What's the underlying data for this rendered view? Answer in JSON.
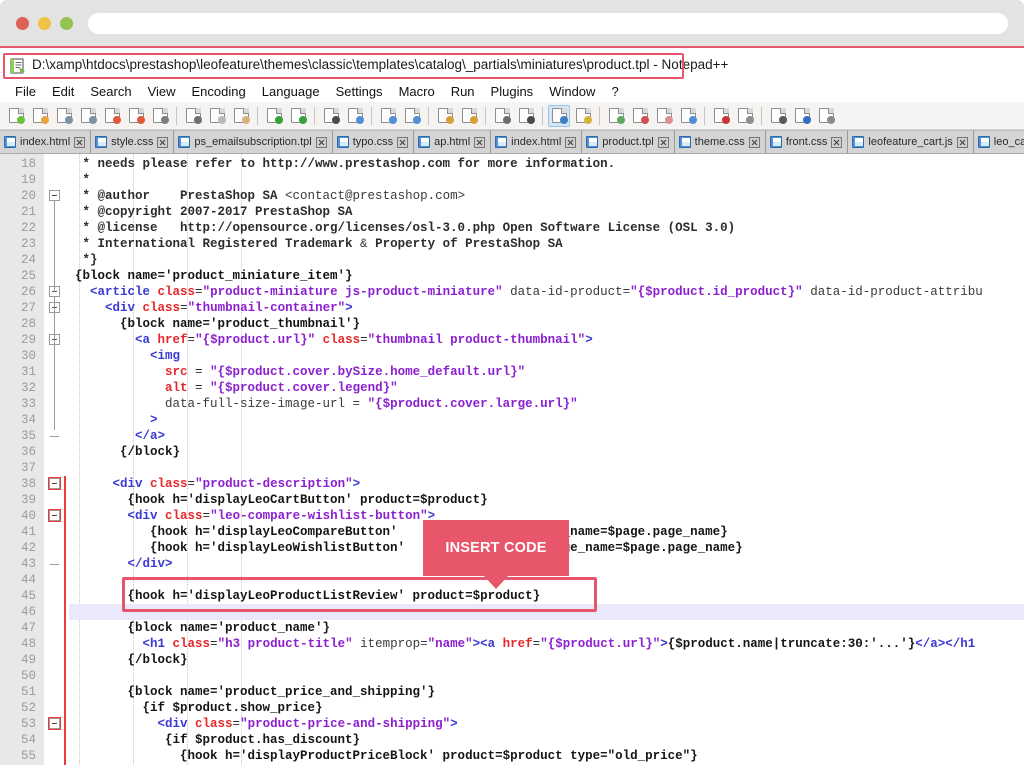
{
  "browser": {
    "traffic_lights": [
      "close",
      "minimize",
      "maximize"
    ],
    "address_value": "",
    "address_placeholder": ""
  },
  "titlebar": {
    "icon": "notepad-plus-plus-icon",
    "title": "D:\\xamp\\htdocs\\prestashop\\leofeature\\themes\\classic\\templates\\catalog\\_partials\\miniatures\\product.tpl - Notepad++",
    "highlight_color": "#e8566b"
  },
  "menu": {
    "items": [
      "File",
      "Edit",
      "Search",
      "View",
      "Encoding",
      "Language",
      "Settings",
      "Macro",
      "Run",
      "Plugins",
      "Window",
      "?"
    ]
  },
  "toolbar": {
    "buttons": [
      "new-file-icon",
      "open-file-icon",
      "save-icon",
      "save-all-icon",
      "close-file-icon",
      "close-all-icon",
      "print-icon",
      "cut-icon",
      "copy-icon",
      "paste-icon",
      "undo-icon",
      "redo-icon",
      "find-icon",
      "replace-icon",
      "zoom-in-icon",
      "zoom-out-icon",
      "sync-vertical-icon",
      "sync-horizontal-icon",
      "word-wrap-icon",
      "show-all-chars-icon",
      "indent-guide-icon",
      "user-defined-dialog-icon",
      "document-map-icon",
      "function-list-icon",
      "folder-workspace-icon",
      "monitoring-icon",
      "record-macro-icon",
      "stop-macro-icon",
      "play-macro-icon",
      "run-macro-multiple-icon",
      "run-dialog-icon"
    ]
  },
  "tabs": [
    {
      "label": "index.html",
      "active": false
    },
    {
      "label": "style.css",
      "active": false
    },
    {
      "label": "ps_emailsubscription.tpl",
      "active": false
    },
    {
      "label": "typo.css",
      "active": false
    },
    {
      "label": "ap.html",
      "active": false
    },
    {
      "label": "index.html",
      "active": false
    },
    {
      "label": "product.tpl",
      "active": true
    },
    {
      "label": "theme.css",
      "active": false
    },
    {
      "label": "front.css",
      "active": false
    },
    {
      "label": "leofeature_cart.js",
      "active": false
    },
    {
      "label": "leo_cart_butto",
      "active": false
    }
  ],
  "editor": {
    "current_line_number": 46,
    "lines": [
      {
        "n": 18,
        "indent": 0,
        "tokens": [
          {
            "t": " * needs please refer to http://www.prestashop.com for more information.",
            "c": "c-comment"
          }
        ]
      },
      {
        "n": 19,
        "indent": 0,
        "tokens": [
          {
            "t": " *",
            "c": "c-comment"
          }
        ]
      },
      {
        "n": 20,
        "indent": 0,
        "fold": "open",
        "tokens": [
          {
            "t": " * @author    PrestaShop SA ",
            "c": "c-comment"
          },
          {
            "t": "<contact@prestashop.com>",
            "c": "c-gray"
          }
        ]
      },
      {
        "n": 21,
        "indent": 0,
        "tokens": [
          {
            "t": " * @copyright 2007-2017 PrestaShop SA",
            "c": "c-comment"
          }
        ]
      },
      {
        "n": 22,
        "indent": 0,
        "tokens": [
          {
            "t": " * @license   http://opensource.org/licenses/osl-3.0.php Open Software License (OSL 3.0)",
            "c": "c-comment"
          }
        ]
      },
      {
        "n": 23,
        "indent": 0,
        "tokens": [
          {
            "t": " * International Registered Trademark ",
            "c": "c-comment"
          },
          {
            "t": "&",
            "c": "c-gray"
          },
          {
            "t": " Property of PrestaShop SA",
            "c": "c-comment"
          }
        ]
      },
      {
        "n": 24,
        "indent": 0,
        "tokens": [
          {
            "t": " *}",
            "c": "c-comment"
          }
        ]
      },
      {
        "n": 25,
        "indent": 0,
        "tokens": [
          {
            "t": "{block name='product_miniature_item'}",
            "c": "c-smarty"
          }
        ]
      },
      {
        "n": 26,
        "indent": 0,
        "fold": "open",
        "tokens": [
          {
            "t": "  ",
            "c": "c-plain"
          },
          {
            "t": "<article ",
            "c": "c-tag"
          },
          {
            "t": "class",
            "c": "c-attr"
          },
          {
            "t": "=",
            "c": "c-punct"
          },
          {
            "t": "\"product-miniature js-product-miniature\"",
            "c": "c-val"
          },
          {
            "t": " data-id-product=",
            "c": "c-gray"
          },
          {
            "t": "\"{$product.id_product}\"",
            "c": "c-val"
          },
          {
            "t": " data-id-product-attribu",
            "c": "c-gray"
          }
        ]
      },
      {
        "n": 27,
        "indent": 0,
        "fold": "open",
        "tokens": [
          {
            "t": "    ",
            "c": "c-plain"
          },
          {
            "t": "<div ",
            "c": "c-tag"
          },
          {
            "t": "class",
            "c": "c-attr"
          },
          {
            "t": "=",
            "c": "c-punct"
          },
          {
            "t": "\"thumbnail-container\"",
            "c": "c-val"
          },
          {
            "t": ">",
            "c": "c-tag"
          }
        ]
      },
      {
        "n": 28,
        "indent": 0,
        "tokens": [
          {
            "t": "      {block name='product_thumbnail'}",
            "c": "c-smarty"
          }
        ]
      },
      {
        "n": 29,
        "indent": 0,
        "fold": "open",
        "tokens": [
          {
            "t": "        ",
            "c": "c-plain"
          },
          {
            "t": "<a ",
            "c": "c-tag"
          },
          {
            "t": "href",
            "c": "c-attr"
          },
          {
            "t": "=",
            "c": "c-punct"
          },
          {
            "t": "\"{$product.url}\"",
            "c": "c-val"
          },
          {
            "t": " ",
            "c": "c-plain"
          },
          {
            "t": "class",
            "c": "c-attr"
          },
          {
            "t": "=",
            "c": "c-punct"
          },
          {
            "t": "\"thumbnail product-thumbnail\"",
            "c": "c-val"
          },
          {
            "t": ">",
            "c": "c-tag"
          }
        ]
      },
      {
        "n": 30,
        "indent": 0,
        "tokens": [
          {
            "t": "          ",
            "c": "c-plain"
          },
          {
            "t": "<img",
            "c": "c-tag"
          }
        ]
      },
      {
        "n": 31,
        "indent": 0,
        "tokens": [
          {
            "t": "            ",
            "c": "c-plain"
          },
          {
            "t": "src",
            "c": "c-attr"
          },
          {
            "t": " = ",
            "c": "c-punct"
          },
          {
            "t": "\"{$product.cover.bySize.home_default.url}\"",
            "c": "c-val"
          }
        ]
      },
      {
        "n": 32,
        "indent": 0,
        "tokens": [
          {
            "t": "            ",
            "c": "c-plain"
          },
          {
            "t": "alt",
            "c": "c-attr"
          },
          {
            "t": " = ",
            "c": "c-punct"
          },
          {
            "t": "\"{$product.cover.legend}\"",
            "c": "c-val"
          }
        ]
      },
      {
        "n": 33,
        "indent": 0,
        "tokens": [
          {
            "t": "            data-full-size-image-url = ",
            "c": "c-gray"
          },
          {
            "t": "\"{$product.cover.large.url}\"",
            "c": "c-val"
          }
        ]
      },
      {
        "n": 34,
        "indent": 0,
        "tokens": [
          {
            "t": "          ",
            "c": "c-plain"
          },
          {
            "t": ">",
            "c": "c-tag"
          }
        ]
      },
      {
        "n": 35,
        "indent": 0,
        "tokens": [
          {
            "t": "        ",
            "c": "c-plain"
          },
          {
            "t": "</a>",
            "c": "c-tag"
          }
        ]
      },
      {
        "n": 36,
        "indent": 0,
        "tokens": [
          {
            "t": "      {/block}",
            "c": "c-smarty"
          }
        ]
      },
      {
        "n": 37,
        "indent": 0,
        "tokens": []
      },
      {
        "n": 38,
        "indent": 0,
        "fold": "open-red",
        "tokens": [
          {
            "t": "     ",
            "c": "c-plain"
          },
          {
            "t": "<div ",
            "c": "c-tag"
          },
          {
            "t": "class",
            "c": "c-attr"
          },
          {
            "t": "=",
            "c": "c-punct"
          },
          {
            "t": "\"product-description\"",
            "c": "c-val"
          },
          {
            "t": ">",
            "c": "c-tag"
          }
        ]
      },
      {
        "n": 39,
        "indent": 0,
        "tokens": [
          {
            "t": "       {hook h='displayLeoCartButton' product=$product}",
            "c": "c-smarty"
          }
        ]
      },
      {
        "n": 40,
        "indent": 0,
        "fold": "open-red",
        "tokens": [
          {
            "t": "       ",
            "c": "c-plain"
          },
          {
            "t": "<div ",
            "c": "c-tag"
          },
          {
            "t": "class",
            "c": "c-attr"
          },
          {
            "t": "=",
            "c": "c-punct"
          },
          {
            "t": "\"leo-compare-wishlist-button\"",
            "c": "c-val"
          },
          {
            "t": ">",
            "c": "c-tag"
          }
        ]
      },
      {
        "n": 41,
        "indent": 0,
        "tokens": [
          {
            "t": "          {hook h='displayLeoCompareButton'                   age_name=$page.page_name}",
            "c": "c-smarty"
          }
        ]
      },
      {
        "n": 42,
        "indent": 0,
        "tokens": [
          {
            "t": "          {hook h='displayLeoWishlistButton'                   page_name=$page.page_name}",
            "c": "c-smarty"
          }
        ]
      },
      {
        "n": 43,
        "indent": 0,
        "tokens": [
          {
            "t": "       ",
            "c": "c-plain"
          },
          {
            "t": "</div>",
            "c": "c-tag"
          }
        ]
      },
      {
        "n": 44,
        "indent": 0,
        "tokens": []
      },
      {
        "n": 45,
        "indent": 0,
        "tokens": [
          {
            "t": "       {hook h='displayLeoProductListReview' product=$product}",
            "c": "c-smarty"
          }
        ]
      },
      {
        "n": 46,
        "indent": 0,
        "tokens": []
      },
      {
        "n": 47,
        "indent": 0,
        "tokens": [
          {
            "t": "       {block name='product_name'}",
            "c": "c-smarty"
          }
        ]
      },
      {
        "n": 48,
        "indent": 0,
        "tokens": [
          {
            "t": "         ",
            "c": "c-plain"
          },
          {
            "t": "<h1 ",
            "c": "c-tag"
          },
          {
            "t": "class",
            "c": "c-attr"
          },
          {
            "t": "=",
            "c": "c-punct"
          },
          {
            "t": "\"h3 product-title\"",
            "c": "c-val"
          },
          {
            "t": " itemprop=",
            "c": "c-gray"
          },
          {
            "t": "\"name\"",
            "c": "c-val"
          },
          {
            "t": ">",
            "c": "c-tag"
          },
          {
            "t": "<a ",
            "c": "c-tag"
          },
          {
            "t": "href",
            "c": "c-attr"
          },
          {
            "t": "=",
            "c": "c-punct"
          },
          {
            "t": "\"{$product.url}\"",
            "c": "c-val"
          },
          {
            "t": ">",
            "c": "c-tag"
          },
          {
            "t": "{$product.name|truncate:30:'...'}",
            "c": "c-smarty"
          },
          {
            "t": "</a></h1",
            "c": "c-tag"
          }
        ]
      },
      {
        "n": 49,
        "indent": 0,
        "tokens": [
          {
            "t": "       {/block}",
            "c": "c-smarty"
          }
        ]
      },
      {
        "n": 50,
        "indent": 0,
        "tokens": []
      },
      {
        "n": 51,
        "indent": 0,
        "tokens": [
          {
            "t": "       {block name='product_price_and_shipping'}",
            "c": "c-smarty"
          }
        ]
      },
      {
        "n": 52,
        "indent": 0,
        "tokens": [
          {
            "t": "         {if $product.show_price}",
            "c": "c-smarty"
          }
        ]
      },
      {
        "n": 53,
        "indent": 0,
        "fold": "open-red",
        "tokens": [
          {
            "t": "           ",
            "c": "c-plain"
          },
          {
            "t": "<div ",
            "c": "c-tag"
          },
          {
            "t": "class",
            "c": "c-attr"
          },
          {
            "t": "=",
            "c": "c-punct"
          },
          {
            "t": "\"product-price-and-shipping\"",
            "c": "c-val"
          },
          {
            "t": ">",
            "c": "c-tag"
          }
        ]
      },
      {
        "n": 54,
        "indent": 0,
        "tokens": [
          {
            "t": "            {if $product.has_discount}",
            "c": "c-smarty"
          }
        ]
      },
      {
        "n": 55,
        "indent": 0,
        "tokens": [
          {
            "t": "              {hook h='displayProductPriceBlock' product=$product type=\"old_price\"}",
            "c": "c-smarty"
          }
        ]
      }
    ]
  },
  "annotations": {
    "callout_label": "INSERT CODE",
    "callout_color": "#e8566b",
    "highlight_line_number": 45,
    "highlight_code": "{hook h='displayLeoProductListReview' product=$product}"
  }
}
